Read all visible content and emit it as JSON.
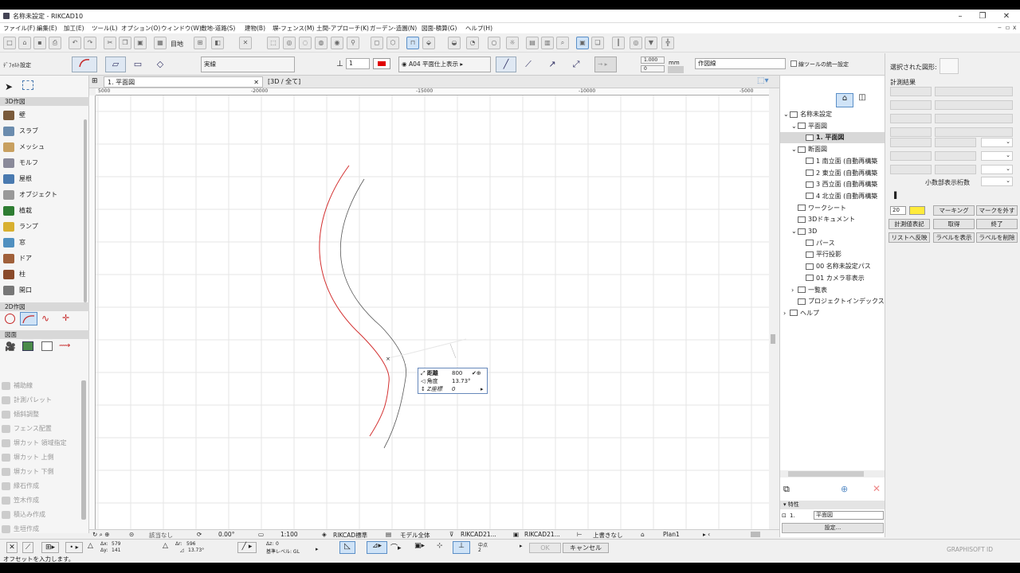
{
  "window": {
    "title": "名称未設定 - RIKCAD10",
    "controls": [
      "–",
      "❐",
      "✕"
    ],
    "sub_controls": [
      "‒",
      "▫",
      "x"
    ]
  },
  "menu": [
    "ファイル(F)",
    "編集(E)",
    "加工(E)",
    "ツール(L)",
    "オプション(O)",
    "ウィンドウ(W)",
    "敷地-道路(S)",
    "建物(B)",
    "塀-フェンス(M)",
    "土間-アプローチ(K)",
    "ガーデン-造園(N)",
    "図面-積算(G)",
    "ヘルプ(H)"
  ],
  "toolbar": {
    "grid_label": "目地"
  },
  "infobar": {
    "default_label": "ﾃﾞﾌｫﾙﾄ設定",
    "line_type": "実線",
    "pen_value": "1",
    "display_mode": "A04 平面仕上表示",
    "offset_value": "1.000",
    "offset_unit": "mm",
    "layer": "作図線",
    "unify_label": "線ツールの統一設定"
  },
  "sidebar": {
    "section_3d": "3D作図",
    "tools_3d": [
      {
        "label": "壁",
        "color": "#7a5a3a"
      },
      {
        "label": "スラブ",
        "color": "#6b8cae"
      },
      {
        "label": "メッシュ",
        "color": "#c8a060"
      },
      {
        "label": "モルフ",
        "color": "#8a8a9a"
      },
      {
        "label": "屋根",
        "color": "#4a7ab0"
      },
      {
        "label": "オブジェクト",
        "color": "#999999"
      },
      {
        "label": "植栽",
        "color": "#2e7d32"
      },
      {
        "label": "ランプ",
        "color": "#d8b030"
      },
      {
        "label": "窓",
        "color": "#5090c0"
      },
      {
        "label": "ドア",
        "color": "#a0603a"
      },
      {
        "label": "柱",
        "color": "#8a4a2a"
      },
      {
        "label": "開口",
        "color": "#777777"
      }
    ],
    "section_2d": "2D作図",
    "section_drawing": "図面",
    "tools_extra": [
      "補助線",
      "計測パレット",
      "傾斜調整",
      "フェンス配置",
      "塀カット 領域指定",
      "塀カット 上側",
      "塀カット 下側",
      "縁石作成",
      "笠木作成",
      "積込み作成",
      "生垣作成"
    ]
  },
  "tabs": [
    {
      "label": "1. 平面図"
    },
    {
      "label": "[3D / 全て]"
    }
  ],
  "ruler": {
    "labels": [
      "5000",
      "-20000",
      "-15000",
      "-10000",
      "-5000"
    ]
  },
  "tracker": {
    "distance_label": "距離",
    "distance_value": "800",
    "angle_label": "角度",
    "angle_value": "13.73°",
    "z_label": "Z座標",
    "z_value": "0"
  },
  "statusbar": {
    "zoom_label": "該当なし",
    "angle": "0.00°",
    "scale": "1:100",
    "layer_set": "RIKCAD標準",
    "model": "モデル全体",
    "pen_set": "RIKCAD21...",
    "mvo": "RIKCAD21...",
    "override": "上書きなし",
    "plan": "Plan1"
  },
  "navigator": {
    "items": [
      {
        "label": "名称未設定",
        "indent": 0,
        "caret": "⌄",
        "selected": false
      },
      {
        "label": "平面図",
        "indent": 1,
        "caret": "⌄",
        "selected": false
      },
      {
        "label": "1. 平面図",
        "indent": 2,
        "caret": "",
        "selected": true
      },
      {
        "label": "断面図",
        "indent": 1,
        "caret": "⌄",
        "selected": false
      },
      {
        "label": "1 南立面 (自動再構築",
        "indent": 2,
        "caret": "",
        "selected": false
      },
      {
        "label": "2 東立面 (自動再構築",
        "indent": 2,
        "caret": "",
        "selected": false
      },
      {
        "label": "3 西立面 (自動再構築",
        "indent": 2,
        "caret": "",
        "selected": false
      },
      {
        "label": "4 北立面 (自動再構築",
        "indent": 2,
        "caret": "",
        "selected": false
      },
      {
        "label": "ワークシート",
        "indent": 1,
        "caret": "",
        "selected": false
      },
      {
        "label": "3Dドキュメント",
        "indent": 1,
        "caret": "",
        "selected": false
      },
      {
        "label": "3D",
        "indent": 1,
        "caret": "⌄",
        "selected": false
      },
      {
        "label": "パース",
        "indent": 2,
        "caret": "",
        "selected": false
      },
      {
        "label": "平行投影",
        "indent": 2,
        "caret": "",
        "selected": false
      },
      {
        "label": "00 名称未設定パス",
        "indent": 2,
        "caret": "",
        "selected": false
      },
      {
        "label": "01 カメラ非表示",
        "indent": 2,
        "caret": "",
        "selected": false
      },
      {
        "label": "一覧表",
        "indent": 1,
        "caret": "›",
        "selected": false
      },
      {
        "label": "プロジェクトインデックス",
        "indent": 1,
        "caret": "",
        "selected": false
      },
      {
        "label": "ヘルプ",
        "indent": 0,
        "caret": "›",
        "selected": false
      }
    ],
    "props_header": "特性",
    "props_id": "1.",
    "props_name": "平面図",
    "settings_button": "設定..."
  },
  "measure_panel": {
    "selected_shape_label": "選択された図形:",
    "result_label": "計測結果",
    "decimal_label": "小数部表示桁数",
    "size_value": "20",
    "buttons": [
      "マーキング",
      "マークを外す",
      "計測値表記",
      "取得",
      "終了",
      "リストへ反映",
      "ラベルを表示",
      "ラベルを削除"
    ]
  },
  "coords": {
    "dx_label": "Δx:",
    "dx_value": "579",
    "dy_label": "Δy:",
    "dy_value": "141",
    "dr_label": "Δr:",
    "dr_value": "596",
    "da_value": "13.73°",
    "dz_label": "Δz:",
    "dz_value": "0",
    "base_label": "基準レベル: GL",
    "mid_label": "中点",
    "mid_value": "2",
    "ok_label": "OK",
    "cancel_label": "キャンセル"
  },
  "message": "オフセットを入力します。",
  "brand": "GRAPHISOFT ID",
  "colors": {
    "accent": "#5b8fc7",
    "curve_red": "#c62828",
    "highlight": "#ffeb3b"
  }
}
